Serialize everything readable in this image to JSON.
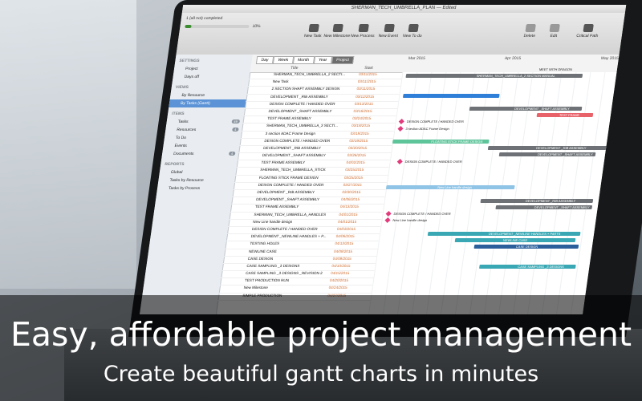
{
  "caption": {
    "headline": "Easy, affordable project management",
    "subline": "Create beautiful gantt charts in minutes"
  },
  "window": {
    "title": "SHERMAN_TECH_UMBRELLA_PLAN — Edited",
    "tasks_completed": "1 (all not) completed",
    "progress_percent": "10%",
    "progress_value": 0.1
  },
  "toolbar": {
    "buttons": [
      "New Task",
      "New Milestone",
      "New Process",
      "New Event",
      "New To do"
    ],
    "right_buttons": [
      "Delete",
      "Edit",
      "Critical Path"
    ]
  },
  "sidebar": {
    "sections": [
      {
        "header": "SETTINGS",
        "items": [
          "Project",
          "Days off"
        ]
      },
      {
        "header": "VIEWS",
        "items": [
          "By Resource",
          "By Tasks (Gantt)"
        ]
      },
      {
        "header": "ITEMS",
        "items": [
          "Tasks",
          "Resources",
          "To Do",
          "Events",
          "Documents"
        ]
      },
      {
        "header": "REPORTS",
        "items": [
          "Global",
          "Tasks by Resource",
          "Tasks by Process"
        ]
      }
    ],
    "selected": "By Tasks (Gantt)",
    "badges": {
      "Tasks": "49",
      "Resources": "4",
      "Documents": "4"
    }
  },
  "grid": {
    "zoom": [
      "Day",
      "Week",
      "Month",
      "Year",
      "Project"
    ],
    "zoom_selected": "Project",
    "col_title": "Title",
    "col_start": "Start",
    "months": [
      "Mar 2015",
      "Apr 2015",
      "May 2015"
    ]
  },
  "tasks": [
    {
      "title": "SHERMAN_TECH_UMBRELLA_2 SECTI...",
      "date": "03/11/2015"
    },
    {
      "title": "New Task",
      "date": "03/11/2015"
    },
    {
      "title": "2 SECTION SHAFT ASSEMBLY DESIGN",
      "date": "03/11/2015"
    },
    {
      "title": "DEVELOPMENT _RIB ASSEMBLY",
      "date": "03/12/2015"
    },
    {
      "title": "DESIGN COMPLETE / HANDED OVER",
      "date": "03/13/2015"
    },
    {
      "title": "DEVELOPMENT _SHAFT ASSEMBLY",
      "date": "03/16/2015"
    },
    {
      "title": "TEST FRAME ASSEMBLY",
      "date": "03/24/2015"
    },
    {
      "title": "SHERMAN_TECH_UMBRELLA_3 SECTI...",
      "date": "03/18/2015"
    },
    {
      "title": "3 section ADAC Frame Design",
      "date": "03/18/2015"
    },
    {
      "title": "DESIGN COMPLETE / HANDED OVER",
      "date": "03/19/2015"
    },
    {
      "title": "DEVELOPMENT _RIB ASSEMBLY",
      "date": "03/20/2015"
    },
    {
      "title": "DEVELOPMENT _SHAFT ASSEMBLY",
      "date": "03/26/2015"
    },
    {
      "title": "TEST FRAME ASSEMBLY",
      "date": "04/02/2015"
    },
    {
      "title": "SHERMAN_TECH_UMBRELLA_STICK",
      "date": "03/25/2015"
    },
    {
      "title": "FLOATING STICK FRAME DESIGN",
      "date": "03/25/2015"
    },
    {
      "title": "DESIGN COMPLETE / HANDED OVER",
      "date": "03/27/2015"
    },
    {
      "title": "DEVELOPMENT _RIB ASSEMBLY",
      "date": "03/30/2015"
    },
    {
      "title": "DEVELOPMENT _SHAFT ASSEMBLY",
      "date": "04/06/2015"
    },
    {
      "title": "TEST FRAME ASSEMBLY",
      "date": "04/13/2015"
    },
    {
      "title": "SHERMAN_TECH_UMBRELLA_HANDLES",
      "date": "04/01/2015"
    },
    {
      "title": "New Line handle design",
      "date": "04/01/2015"
    },
    {
      "title": "DESIGN COMPLETE / HANDED OVER",
      "date": "04/03/2015"
    },
    {
      "title": "DEVELOPMENT _NEWLINE HANDLES + P...",
      "date": "04/06/2015"
    },
    {
      "title": "TESTING HOLES",
      "date": "04/13/2015"
    },
    {
      "title": "NEWLINE CASE",
      "date": "04/08/2015"
    },
    {
      "title": "CASE DESIGN",
      "date": "04/08/2015"
    },
    {
      "title": "CASE SAMPLING _3 DESIGNS",
      "date": "04/10/2015"
    },
    {
      "title": "CASE SAMPLING _3 DESIGNS _REVISION 2",
      "date": "04/15/2015"
    },
    {
      "title": "TEST PRODUCTION RUN",
      "date": "04/20/2015"
    },
    {
      "title": "New Milestone",
      "date": "04/24/2015"
    },
    {
      "title": "SIMPLE PRODUCTION",
      "date": "04/27/2015"
    }
  ],
  "chart_labels": {
    "summary1": "MEET WITH DRAGON",
    "summary1b": "SHERMAN_TECH_UMBRELLA_2 SECTION MANUAL",
    "dev_shaft": "DEVELOPMENT _SHAFT ASSEMBLY",
    "design_handed": "DESIGN COMPLETE / HANDED OVER",
    "frame_design": "3 section ADAC Frame Design",
    "test_frame": "TEST FRAME",
    "dev_rib": "DEVELOPMENT _RIB ASSEMBLY",
    "stick_design": "FLOATING STICK FRAME DESIGN",
    "handle_design": "New Line handle design",
    "dev_handles": "DEVELOPMENT _NEWLINE HANDLES + PARTS",
    "newline_case": "NEWLINE CASE",
    "case_design": "CASE DESIGN",
    "case_sampling": "CASE SAMPLING _3 DESIGNS"
  },
  "colors": {
    "blue_bar": "#2f7fd8",
    "red_bar": "#e8626a",
    "green_bar": "#5ec49a",
    "grey_bar": "#6e7276",
    "light_blue_bar": "#8fc4e6",
    "teal_bar": "#3aa8b4",
    "dark_blue_bar": "#2a5f9c",
    "milestone": "#e23b7c",
    "sidebar_selected": "#5b93d6"
  }
}
